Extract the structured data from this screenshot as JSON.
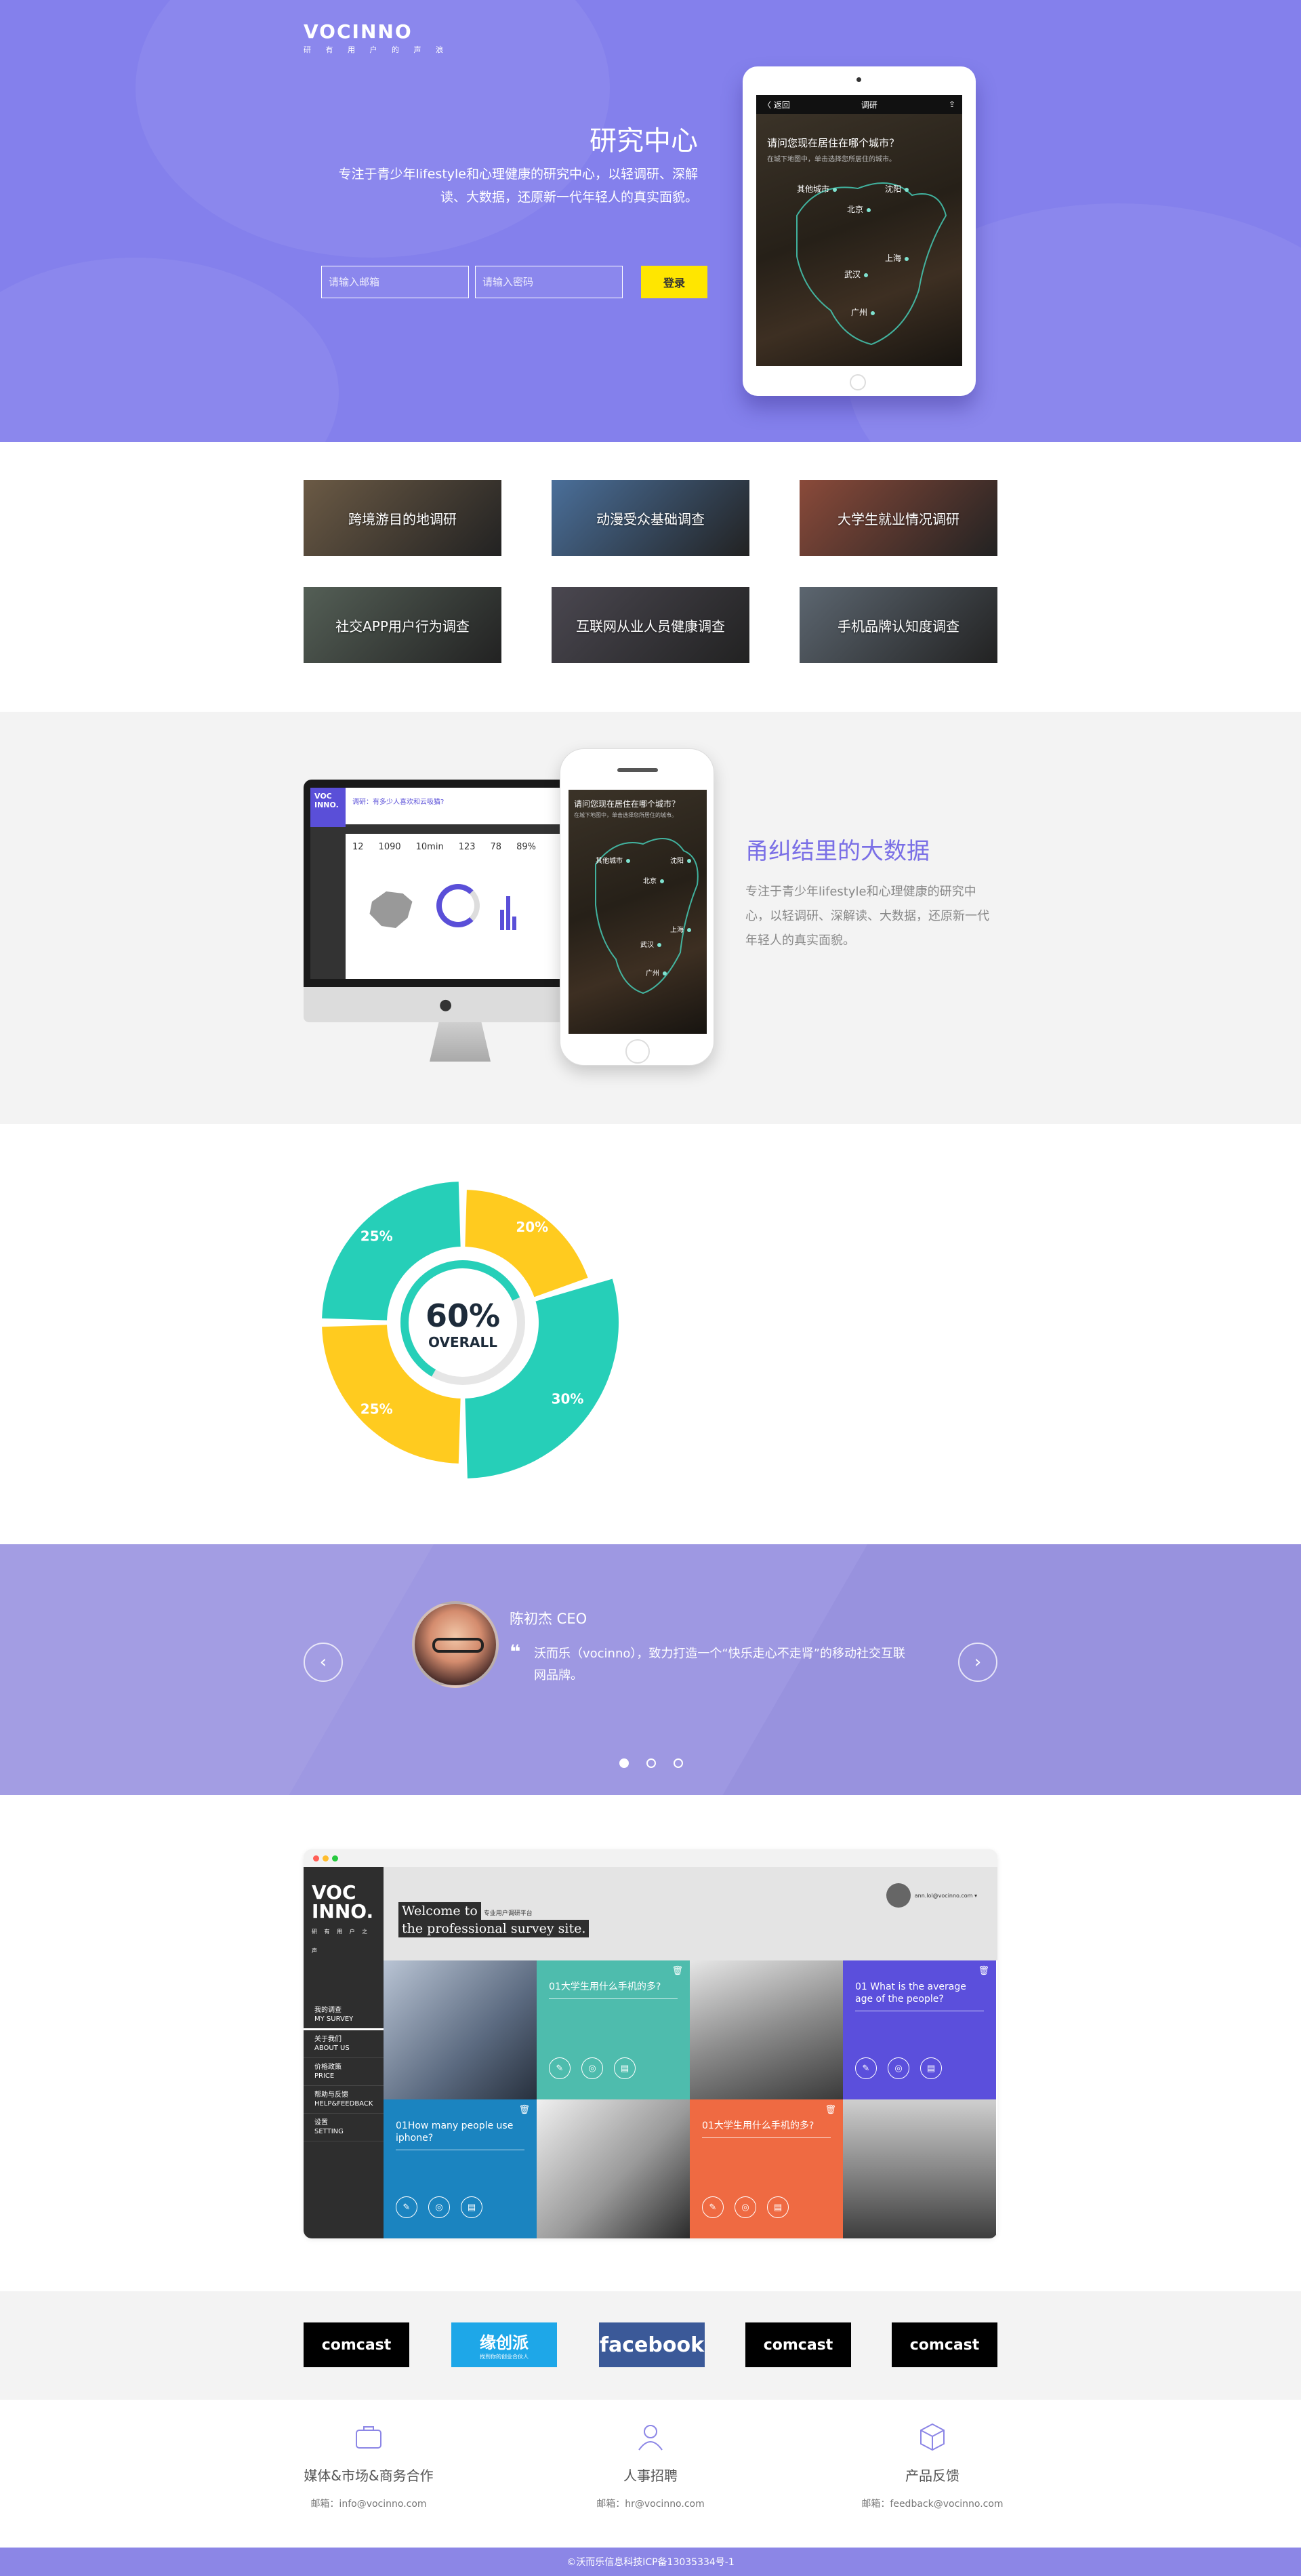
{
  "hero": {
    "logo_text": "VOCINNO",
    "logo_sub": "研 有 用 户 的 声 浪",
    "title": "研究中心",
    "desc": "专注于青少年lifestyle和心理健康的研究中心，以轻调研、深解读、大数据，还原新一代年轻人的真实面貌。",
    "email_placeholder": "请输入邮箱",
    "password_placeholder": "请输入密码",
    "login_label": "登录",
    "tablet": {
      "back": "〈 返回",
      "screen_title": "调研",
      "question": "请问您现在居住在哪个城市？",
      "sub": "在城下地图中，单击选择您所居住的城市。",
      "cities": [
        "其他城市",
        "沈阳",
        "北京",
        "上海",
        "武汉",
        "广州"
      ]
    }
  },
  "thumbnails": [
    {
      "label": "跨境游目的地调研",
      "color": "#6b5a45"
    },
    {
      "label": "动漫受众基础调查",
      "color": "#4a6f9a"
    },
    {
      "label": "大学生就业情况调研",
      "color": "#8a4a3a"
    },
    {
      "label": "社交APP用户行为调查",
      "color": "#545f56"
    },
    {
      "label": "互联网从业人员健康调查",
      "color": "#4a4750"
    },
    {
      "label": "手机品牌认知度调查",
      "color": "#5c6670"
    }
  ],
  "section2": {
    "title": "甬纠结里的大数据",
    "desc": "专注于青少年lifestyle和心理健康的研究中心，以轻调研、深解读、大数据，还原新一代年轻人的真实面貌。",
    "dash_title": "调研：有多少人喜欢和云吸猫?",
    "dash_logo": "VOC INNO.",
    "stats": [
      "12",
      "1090",
      "10min",
      "123",
      "78",
      "89%"
    ]
  },
  "donut": {
    "center_value": "60%",
    "center_label": "OVERALL",
    "segments": [
      {
        "label": "25%",
        "value": 25,
        "color": "#26cfb8"
      },
      {
        "label": "20%",
        "value": 20,
        "color": "#ffcb1f"
      },
      {
        "label": "30%",
        "value": 30,
        "color": "#26cfb8"
      },
      {
        "label": "25%",
        "value": 25,
        "color": "#ffcb1f"
      }
    ],
    "inner_progress": 0.6
  },
  "testimonial": {
    "name": "陈初杰   CEO",
    "quote": "沃而乐（vocinno），致力打造一个“快乐走心不走肾”的移动社交互联网品牌。",
    "prev": "‹",
    "next": "›",
    "dots": 3,
    "active_dot": 0
  },
  "app": {
    "logo": "VOC INNO.",
    "logo_sub": "研 有 用 户 之 声",
    "menu": [
      {
        "cn": "我的调查",
        "en": "MY SURVEY"
      },
      {
        "cn": "关于我们",
        "en": "ABOUT US"
      },
      {
        "cn": "价格政策",
        "en": "PRICE"
      },
      {
        "cn": "帮助与反馈",
        "en": "HELP&FEEDBACK"
      },
      {
        "cn": "设置",
        "en": "SETTING"
      }
    ],
    "welcome_1": "Welcome to",
    "welcome_tag": "专业用户调研平台",
    "welcome_2": "the professional survey site.",
    "user_email": "ann.lol@vocinno.com ▾",
    "tiles": {
      "t1": "01大学生用什么手机的多?",
      "t2": "01 What is the average age of the people?",
      "t3": "01How many people use iphone?",
      "t4": "01大学生用什么手机的多?"
    }
  },
  "partners": [
    {
      "name": "comcast",
      "style": "dark"
    },
    {
      "name": "缘创派",
      "style": "blue",
      "sub": "找到你的创业合伙人"
    },
    {
      "name": "facebook",
      "style": "fb"
    },
    {
      "name": "comcast",
      "style": "dark"
    },
    {
      "name": "comcast",
      "style": "dark"
    }
  ],
  "contacts": [
    {
      "title": "媒体&市场&商务合作",
      "mail": "邮箱：info@vocinno.com",
      "icon": "briefcase-icon"
    },
    {
      "title": "人事招聘",
      "mail": "邮箱：hr@vocinno.com",
      "icon": "person-icon"
    },
    {
      "title": "产品反馈",
      "mail": "邮箱：feedback@vocinno.com",
      "icon": "box-icon"
    }
  ],
  "footer": "©沃而乐信息科技ICP备13035334号-1"
}
